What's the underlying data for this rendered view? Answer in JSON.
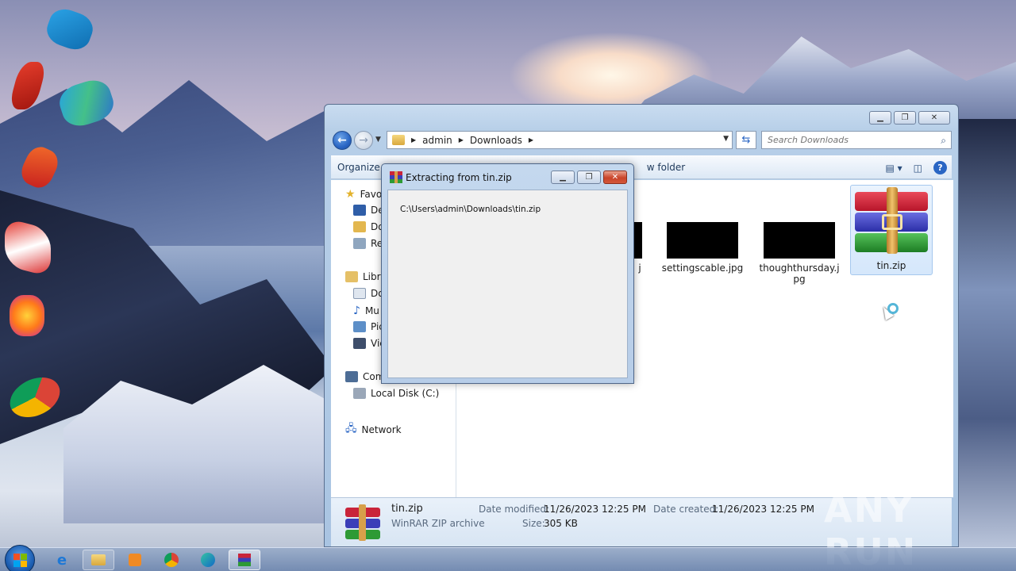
{
  "explorer": {
    "address": {
      "crumb_1": "admin",
      "crumb_2": "Downloads"
    },
    "search_placeholder": "Search Downloads",
    "toolbar": {
      "organize": "Organize",
      "new_folder": "w folder"
    },
    "nav": {
      "favorites": "Favo",
      "desktop": "De",
      "downloads": "Do",
      "recent": "Re",
      "libraries": "Libra",
      "documents": "Do",
      "music": "Mu",
      "pictures": "Pic",
      "videos": "Vic",
      "computer": "Com",
      "local_disk": "Local Disk (C:)",
      "network": "Network"
    },
    "files": [
      {
        "name": "settingscable.jpg"
      },
      {
        "name": "thoughthursday.j pg",
        "line1": "thoughthursday.j",
        "line2": "pg"
      },
      {
        "name": "tin.zip"
      }
    ],
    "partial_file_label": "j",
    "details": {
      "name": "tin.zip",
      "type": "WinRAR ZIP archive",
      "date_modified_label": "Date modified:",
      "date_modified": "11/26/2023 12:25 PM",
      "size_label": "Size:",
      "size": "305 KB",
      "date_created_label": "Date created:",
      "date_created": "11/26/2023 12:25 PM"
    }
  },
  "dialog": {
    "title": "Extracting from tin.zip",
    "path": "C:\\Users\\admin\\Downloads\\tin.zip"
  },
  "watermark": "ANY RUN",
  "colors": {
    "accent": "#2a66c4",
    "selection": "#d5e7fb",
    "close_red": "#c9442a"
  }
}
